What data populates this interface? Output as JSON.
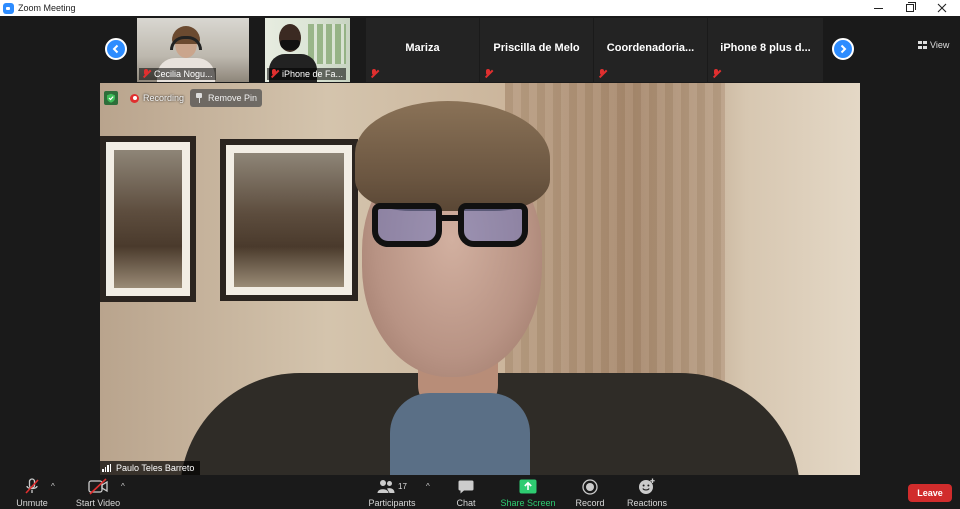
{
  "window": {
    "title": "Zoom Meeting"
  },
  "strip": {
    "view_label": "View",
    "tiles": [
      {
        "name": "Cecilia Nogu...",
        "type": "video"
      },
      {
        "name": "iPhone de Fa...",
        "type": "video"
      },
      {
        "name": "Mariza",
        "type": "name"
      },
      {
        "name": "Priscilla de Melo",
        "type": "name"
      },
      {
        "name": "Coordenadoria...",
        "type": "name"
      },
      {
        "name": "iPhone 8 plus d...",
        "type": "name"
      }
    ]
  },
  "main": {
    "recording_label": "Recording",
    "remove_pin_label": "Remove Pin",
    "speaker_name": "Paulo Teles Barreto"
  },
  "toolbar": {
    "unmute_label": "Unmute",
    "start_video_label": "Start Video",
    "participants_label": "Participants",
    "participants_count": "17",
    "chat_label": "Chat",
    "share_screen_label": "Share Screen",
    "record_label": "Record",
    "reactions_label": "Reactions",
    "leave_label": "Leave"
  },
  "colors": {
    "accent_blue": "#2d8cff",
    "share_green": "#2ecc71",
    "leave_red": "#d12c2c",
    "muted_red": "#e02f2f"
  }
}
